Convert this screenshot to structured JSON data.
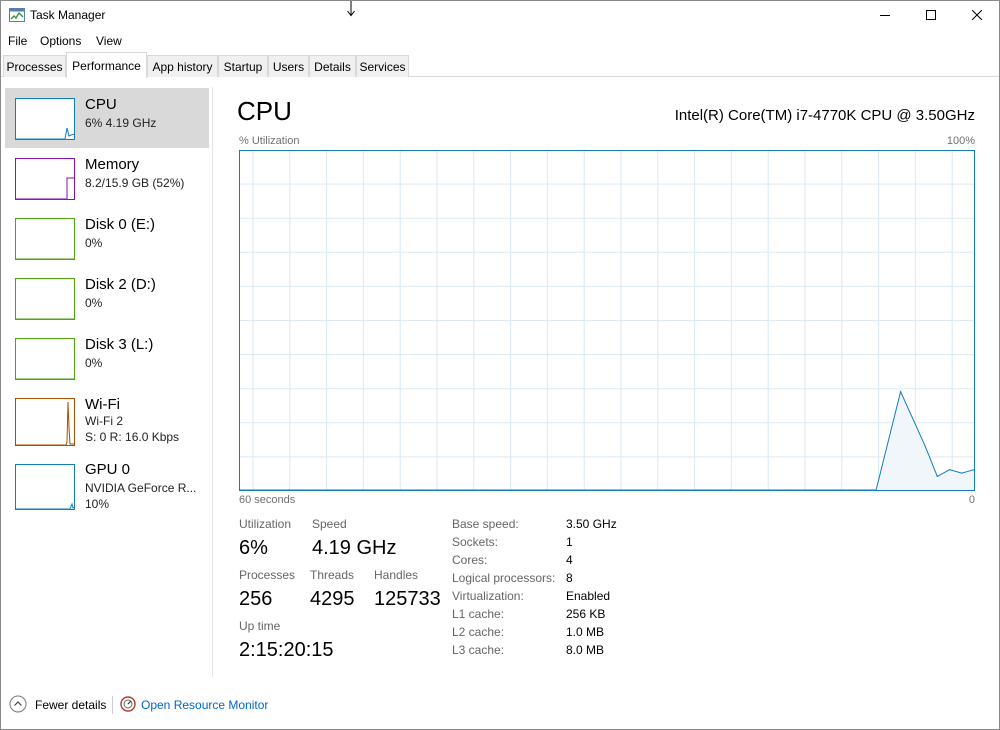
{
  "window": {
    "title": "Task Manager"
  },
  "menu": [
    "File",
    "Options",
    "View"
  ],
  "tabs": [
    "Processes",
    "Performance",
    "App history",
    "Startup",
    "Users",
    "Details",
    "Services"
  ],
  "sidebar": {
    "items": [
      {
        "title": "CPU",
        "sub": [
          "6% 4.19 GHz"
        ],
        "color": "#117dbb"
      },
      {
        "title": "Memory",
        "sub": [
          "8.2/15.9 GB (52%)"
        ],
        "color": "#8b12ae"
      },
      {
        "title": "Disk 0 (E:)",
        "sub": [
          "0%"
        ],
        "color": "#4da60c"
      },
      {
        "title": "Disk 2 (D:)",
        "sub": [
          "0%"
        ],
        "color": "#4da60c"
      },
      {
        "title": "Disk 3 (L:)",
        "sub": [
          "0%"
        ],
        "color": "#4da60c"
      },
      {
        "title": "Wi-Fi",
        "sub": [
          "Wi-Fi 2",
          "S: 0 R: 16.0 Kbps"
        ],
        "color": "#a74f01"
      },
      {
        "title": "GPU 0",
        "sub": [
          "NVIDIA GeForce R...",
          "10%"
        ],
        "color": "#117dbb"
      }
    ]
  },
  "main": {
    "title": "CPU",
    "model": "Intel(R) Core(TM) i7-4770K CPU @ 3.50GHz",
    "y_label": "% Utilization",
    "y_max": "100%",
    "x_label": "60 seconds",
    "x_min": "0",
    "accent_color": "#117dbb"
  },
  "chart_data": {
    "type": "area",
    "x": [
      60,
      55,
      50,
      45,
      40,
      35,
      30,
      25,
      20,
      15,
      10,
      8,
      6,
      4,
      3,
      2,
      1,
      0
    ],
    "values": [
      0,
      0,
      0,
      0,
      0,
      0,
      0,
      0,
      0,
      0,
      0,
      0,
      29,
      13,
      4,
      6,
      5,
      6
    ],
    "ylim": [
      0,
      100
    ],
    "xlabel": "60 seconds",
    "ylabel": "% Utilization",
    "grid": true
  },
  "stats": {
    "utilization_label": "Utilization",
    "utilization": "6%",
    "speed_label": "Speed",
    "speed": "4.19 GHz",
    "processes_label": "Processes",
    "processes": "256",
    "threads_label": "Threads",
    "threads": "4295",
    "handles_label": "Handles",
    "handles": "125733",
    "uptime_label": "Up time",
    "uptime": "2:15:20:15"
  },
  "specs": [
    {
      "label": "Base speed:",
      "value": "3.50 GHz"
    },
    {
      "label": "Sockets:",
      "value": "1"
    },
    {
      "label": "Cores:",
      "value": "4"
    },
    {
      "label": "Logical processors:",
      "value": "8"
    },
    {
      "label": "Virtualization:",
      "value": "Enabled"
    },
    {
      "label": "L1 cache:",
      "value": "256 KB"
    },
    {
      "label": "L2 cache:",
      "value": "1.0 MB"
    },
    {
      "label": "L3 cache:",
      "value": "8.0 MB"
    }
  ],
  "footer": {
    "fewer": "Fewer details",
    "monitor": "Open Resource Monitor"
  }
}
